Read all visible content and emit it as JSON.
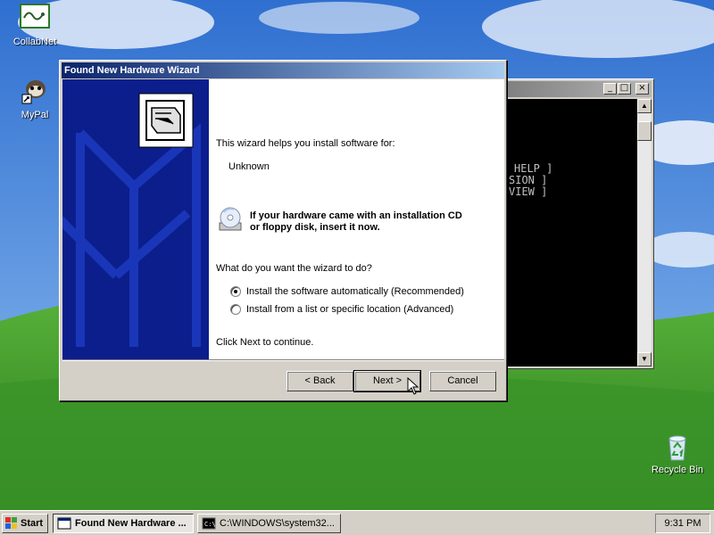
{
  "desktop": {
    "icons": [
      {
        "label": "CollabNet",
        "icon": "collabnet-icon"
      },
      {
        "label": "MyPal",
        "icon": "mypal-shortcut-icon"
      },
      {
        "label": "Recycle Bin",
        "icon": "recycle-bin-icon"
      }
    ]
  },
  "console": {
    "lines": [
      "HELP ]",
      "SION ]",
      "VIEW ]"
    ],
    "buttons": {
      "minimize": "_",
      "maximize": "□",
      "close": "×"
    }
  },
  "wizard": {
    "title": "Found New Hardware Wizard",
    "intro": "This wizard helps you install software for:",
    "device": "Unknown",
    "cd_prompt_line1": "If your hardware came with an installation CD",
    "cd_prompt_line2": "or floppy disk, insert it now.",
    "question": "What do you want the wizard to do?",
    "options": [
      {
        "label": "Install the software automatically (Recommended)",
        "selected": true
      },
      {
        "label": "Install from a list or specific location (Advanced)",
        "selected": false
      }
    ],
    "continue_text": "Click Next to continue.",
    "buttons": {
      "back": "< Back",
      "next": "Next >",
      "cancel": "Cancel"
    }
  },
  "taskbar": {
    "start_label": "Start",
    "tasks": [
      {
        "label": "Found New Hardware ...",
        "active": true
      },
      {
        "label": "C:\\WINDOWS\\system32...",
        "active": false
      }
    ],
    "clock": "9:31 PM"
  },
  "colors": {
    "sky": "#3f7fd6",
    "grass": "#3e9a2c",
    "wizard_side": "#0b1e8c",
    "titlebar_active": "#0a246a"
  }
}
